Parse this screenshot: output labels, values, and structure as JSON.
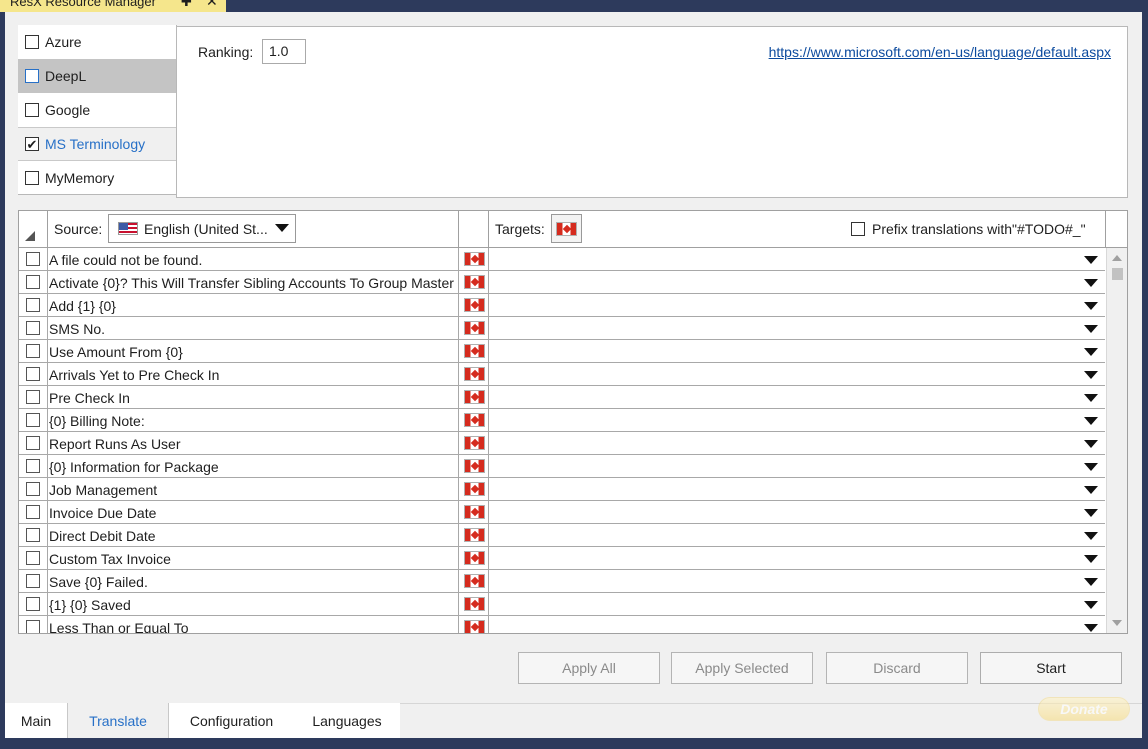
{
  "window": {
    "title": "ResX Resource Manager",
    "pin_icon": "pin-icon",
    "close_icon": "close-icon"
  },
  "providers": [
    {
      "label": "Azure",
      "checked": false
    },
    {
      "label": "DeepL",
      "checked": false
    },
    {
      "label": "Google",
      "checked": false
    },
    {
      "label": "MS Terminology",
      "checked": true
    },
    {
      "label": "MyMemory",
      "checked": false
    }
  ],
  "settings": {
    "ranking_label": "Ranking:",
    "ranking_value": "1.0",
    "link": "https://www.microsoft.com/en-us/language/default.aspx"
  },
  "grid": {
    "source_label": "Source:",
    "source_value": "English (United St...",
    "targets_label": "Targets:",
    "prefix_label": "Prefix translations with\"#TODO#_\"",
    "rows": [
      "A file could not be found.",
      "Activate {0}? This Will Transfer Sibling Accounts To Group Master",
      "Add {1} {0}",
      "SMS No.",
      "Use Amount From {0}",
      "Arrivals Yet to Pre Check In",
      "Pre Check In",
      "{0} Billing Note:",
      "Report Runs As User",
      "{0} Information for Package",
      "Job Management",
      "Invoice Due Date",
      "Direct Debit Date",
      "Custom Tax Invoice",
      "Save {0} Failed.",
      "{1} {0} Saved",
      "Less Than or Equal To"
    ]
  },
  "buttons": {
    "apply_all": "Apply All",
    "apply_selected": "Apply Selected",
    "discard": "Discard",
    "start": "Start"
  },
  "tabs": {
    "main": "Main",
    "translate": "Translate",
    "configuration": "Configuration",
    "languages": "Languages"
  },
  "donate": "Donate",
  "colors": {
    "accent": "#2770c7",
    "title_tab": "#f5e68c",
    "frame": "#2d3a5c"
  }
}
